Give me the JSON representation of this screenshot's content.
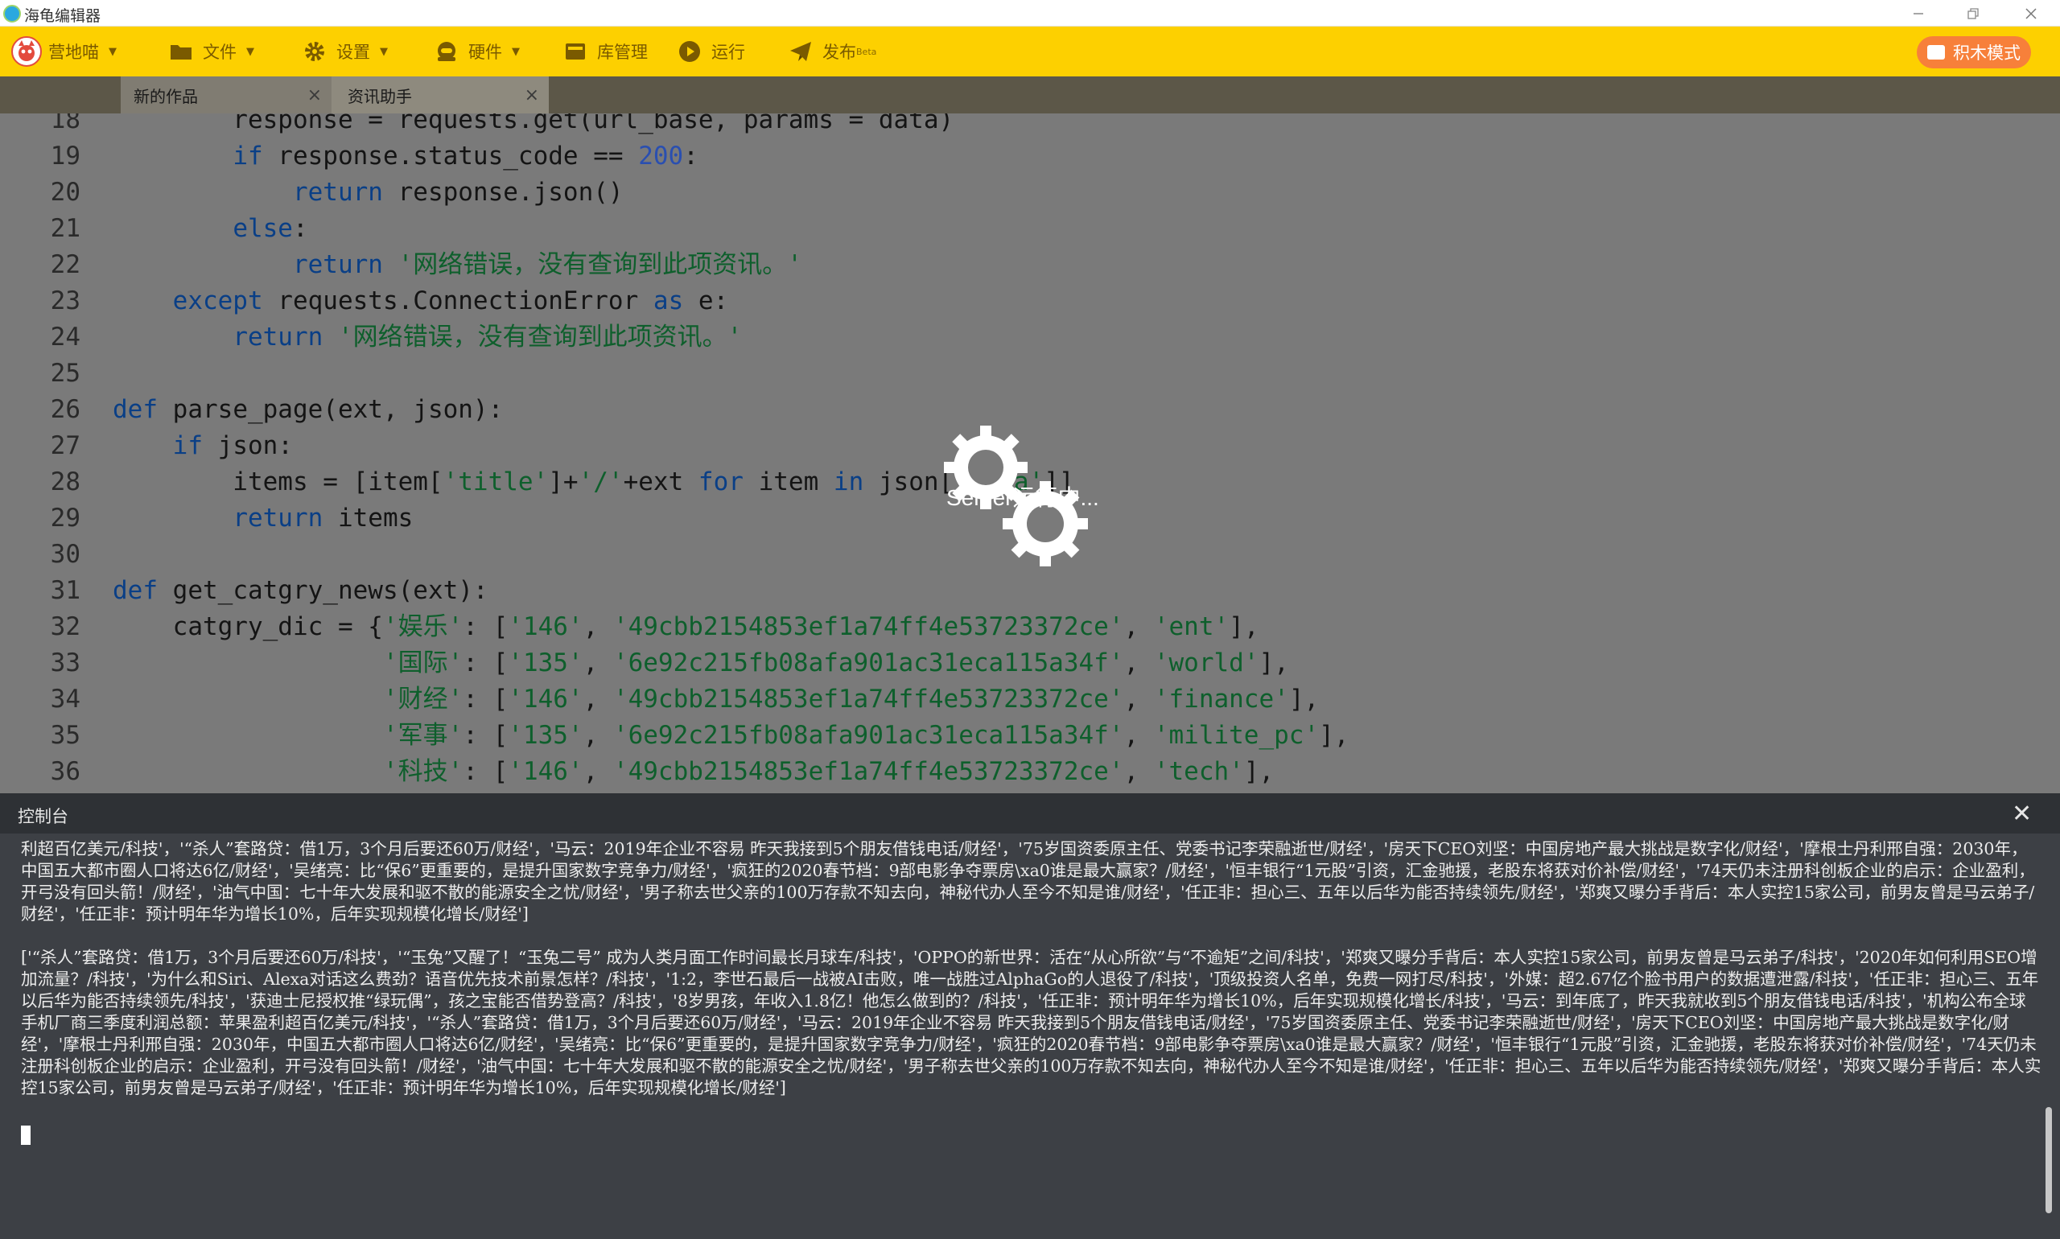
{
  "window": {
    "title": "海龟编辑器",
    "minimize_icon": "minimize-icon",
    "restore_icon": "restore-icon",
    "close_icon": "close-icon"
  },
  "toolbar": {
    "camp": "营地喵",
    "file": "文件",
    "settings": "设置",
    "hardware": "硬件",
    "library": "库管理",
    "run": "运行",
    "publish": "发布",
    "publish_badge": "Beta",
    "block_mode": "积木模式",
    "accent_color": "#fdd000",
    "block_mode_color": "#f7803a"
  },
  "tabs": [
    {
      "label": "新的作品"
    },
    {
      "label": "资讯助手"
    }
  ],
  "editor": {
    "lines": [
      {
        "num": "18",
        "parts": [
          [
            "",
            "        response = requests.get(url_base, params = data)"
          ]
        ]
      },
      {
        "num": "19",
        "parts": [
          [
            "",
            "        "
          ],
          [
            "kw",
            "if"
          ],
          [
            "",
            " response.status_code == "
          ],
          [
            "num",
            "200"
          ],
          [
            "",
            ":"
          ]
        ]
      },
      {
        "num": "20",
        "parts": [
          [
            "",
            "            "
          ],
          [
            "kw",
            "return"
          ],
          [
            "",
            " response.json()"
          ]
        ]
      },
      {
        "num": "21",
        "parts": [
          [
            "",
            "        "
          ],
          [
            "kw",
            "else"
          ],
          [
            "",
            ":"
          ]
        ]
      },
      {
        "num": "22",
        "parts": [
          [
            "",
            "            "
          ],
          [
            "kw",
            "return"
          ],
          [
            "",
            " "
          ],
          [
            "str",
            "'网络错误，没有查询到此项资讯。'"
          ]
        ]
      },
      {
        "num": "23",
        "parts": [
          [
            "",
            "    "
          ],
          [
            "kw",
            "except"
          ],
          [
            "",
            " requests.ConnectionError "
          ],
          [
            "kw",
            "as"
          ],
          [
            "",
            " e:"
          ]
        ]
      },
      {
        "num": "24",
        "parts": [
          [
            "",
            "        "
          ],
          [
            "kw",
            "return"
          ],
          [
            "",
            " "
          ],
          [
            "str",
            "'网络错误，没有查询到此项资讯。'"
          ]
        ]
      },
      {
        "num": "25",
        "parts": [
          [
            "",
            ""
          ]
        ]
      },
      {
        "num": "26",
        "parts": [
          [
            "kw",
            "def"
          ],
          [
            "",
            " parse_page(ext, json):"
          ]
        ]
      },
      {
        "num": "27",
        "parts": [
          [
            "",
            "    "
          ],
          [
            "kw",
            "if"
          ],
          [
            "",
            " json:"
          ]
        ]
      },
      {
        "num": "28",
        "parts": [
          [
            "",
            "        items = [item["
          ],
          [
            "str",
            "'title'"
          ],
          [
            "",
            "]+"
          ],
          [
            "str",
            "'/'"
          ],
          [
            "",
            "+ext "
          ],
          [
            "kw",
            "for"
          ],
          [
            "",
            " item "
          ],
          [
            "kw",
            "in"
          ],
          [
            "",
            " json["
          ],
          [
            "str",
            "'data'"
          ],
          [
            "",
            "]]"
          ]
        ]
      },
      {
        "num": "29",
        "parts": [
          [
            "",
            "        "
          ],
          [
            "kw",
            "return"
          ],
          [
            "",
            " items"
          ]
        ]
      },
      {
        "num": "30",
        "parts": [
          [
            "",
            ""
          ]
        ]
      },
      {
        "num": "31",
        "parts": [
          [
            "kw",
            "def"
          ],
          [
            "",
            " get_catgry_news(ext):"
          ]
        ]
      },
      {
        "num": "32",
        "parts": [
          [
            "",
            "    catgry_dic = {"
          ],
          [
            "str",
            "'娱乐'"
          ],
          [
            "",
            ": ["
          ],
          [
            "str",
            "'146'"
          ],
          [
            "",
            ", "
          ],
          [
            "str",
            "'49cbb2154853ef1a74ff4e53723372ce'"
          ],
          [
            "",
            ", "
          ],
          [
            "str",
            "'ent'"
          ],
          [
            "",
            "],"
          ]
        ]
      },
      {
        "num": "33",
        "parts": [
          [
            "",
            "                  "
          ],
          [
            "str",
            "'国际'"
          ],
          [
            "",
            ": ["
          ],
          [
            "str",
            "'135'"
          ],
          [
            "",
            ", "
          ],
          [
            "str",
            "'6e92c215fb08afa901ac31eca115a34f'"
          ],
          [
            "",
            ", "
          ],
          [
            "str",
            "'world'"
          ],
          [
            "",
            "],"
          ]
        ]
      },
      {
        "num": "34",
        "parts": [
          [
            "",
            "                  "
          ],
          [
            "str",
            "'财经'"
          ],
          [
            "",
            ": ["
          ],
          [
            "str",
            "'146'"
          ],
          [
            "",
            ", "
          ],
          [
            "str",
            "'49cbb2154853ef1a74ff4e53723372ce'"
          ],
          [
            "",
            ", "
          ],
          [
            "str",
            "'finance'"
          ],
          [
            "",
            "],"
          ]
        ]
      },
      {
        "num": "35",
        "parts": [
          [
            "",
            "                  "
          ],
          [
            "str",
            "'军事'"
          ],
          [
            "",
            ": ["
          ],
          [
            "str",
            "'135'"
          ],
          [
            "",
            ", "
          ],
          [
            "str",
            "'6e92c215fb08afa901ac31eca115a34f'"
          ],
          [
            "",
            ", "
          ],
          [
            "str",
            "'milite_pc'"
          ],
          [
            "",
            "],"
          ]
        ]
      },
      {
        "num": "36",
        "parts": [
          [
            "",
            "                  "
          ],
          [
            "str",
            "'科技'"
          ],
          [
            "",
            ": ["
          ],
          [
            "str",
            "'146'"
          ],
          [
            "",
            ", "
          ],
          [
            "str",
            "'49cbb2154853ef1a74ff4e53723372ce'"
          ],
          [
            "",
            ", "
          ],
          [
            "str",
            "'tech'"
          ],
          [
            "",
            "],"
          ]
        ]
      }
    ]
  },
  "overlay": {
    "status": "Server运行中...",
    "icon": "gears-icon"
  },
  "console": {
    "title": "控制台",
    "close_icon": "close-icon",
    "output_1": "利超百亿美元/科技'，'“杀人”套路贷：借1万，3个月后要还60万/财经'，'马云：2019年企业不容易 昨天我接到5个朋友借钱电话/财经'，'75岁国资委原主任、党委书记李荣融逝世/财经'，'房天下CEO刘坚：中国房地产最大挑战是数字化/财经'，'摩根士丹利邢自强：2030年，中国五大都市圈人口将达6亿/财经'，'吴绪亮：比“保6”更重要的，是提升国家数字竞争力/财经'，'疯狂的2020春节档：9部电影争夺票房\\xa0谁是最大赢家？/财经'，'恒丰银行“1元股”引资，汇金驰援，老股东将获对价补偿/财经'，'74天仍未注册科创板企业的启示：企业盈利，开弓没有回头箭！/财经'，'油气中国：七十年大发展和驱不散的能源安全之忧/财经'，'男子称去世父亲的100万存款不知去向，神秘代办人至今不知是谁/财经'，'任正非：担心三、五年以后华为能否持续领先/财经'，'郑爽又曝分手背后：本人实控15家公司，前男友曾是马云弟子/财经'，'任正非：预计明年华为增长10%，后年实现规模化增长/财经']",
    "output_2": "['“杀人”套路贷：借1万，3个月后要还60万/科技'，'“玉兔”又醒了！“玉兔二号” 成为人类月面工作时间最长月球车/科技'，'OPPO的新世界：活在“从心所欲”与“不逾矩”之间/科技'，'郑爽又曝分手背后：本人实控15家公司，前男友曾是马云弟子/科技'，'2020年如何利用SEO增加流量？/科技'，'为什么和Siri、Alexa对话这么费劲？语音优先技术前景怎样？/科技'，'1:2，李世石最后一战被AI击败，唯一战胜过AlphaGo的人退役了/科技'，'顶级投资人名单，免费一网打尽/科技'，'外媒：超2.67亿个脸书用户的数据遭泄露/科技'，'任正非：担心三、五年以后华为能否持续领先/科技'，'获迪士尼授权推“绿玩偶”，孩之宝能否借势登高？/科技'，'8岁男孩，年收入1.8亿！他怎么做到的？/科技'，'任正非：预计明年华为增长10%，后年实现规模化增长/科技'，'马云：到年底了，昨天我就收到5个朋友借钱电话/科技'，'机构公布全球手机厂商三季度利润总额：苹果盈利超百亿美元/科技'，'“杀人”套路贷：借1万，3个月后要还60万/财经'，'马云：2019年企业不容易 昨天我接到5个朋友借钱电话/财经'，'75岁国资委原主任、党委书记李荣融逝世/财经'，'房天下CEO刘坚：中国房地产最大挑战是数字化/财经'，'摩根士丹利邢自强：2030年，中国五大都市圈人口将达6亿/财经'，'吴绪亮：比“保6”更重要的，是提升国家数字竞争力/财经'，'疯狂的2020春节档：9部电影争夺票房\\xa0谁是最大赢家？/财经'，'恒丰银行“1元股”引资，汇金驰援，老股东将获对价补偿/财经'，'74天仍未注册科创板企业的启示：企业盈利，开弓没有回头箭！/财经'，'油气中国：七十年大发展和驱不散的能源安全之忧/财经'，'男子称去世父亲的100万存款不知去向，神秘代办人至今不知是谁/财经'，'任正非：担心三、五年以后华为能否持续领先/财经'，'郑爽又曝分手背后：本人实控15家公司，前男友曾是马云弟子/财经'，'任正非：预计明年华为增长10%，后年实现规模化增长/财经']"
  }
}
